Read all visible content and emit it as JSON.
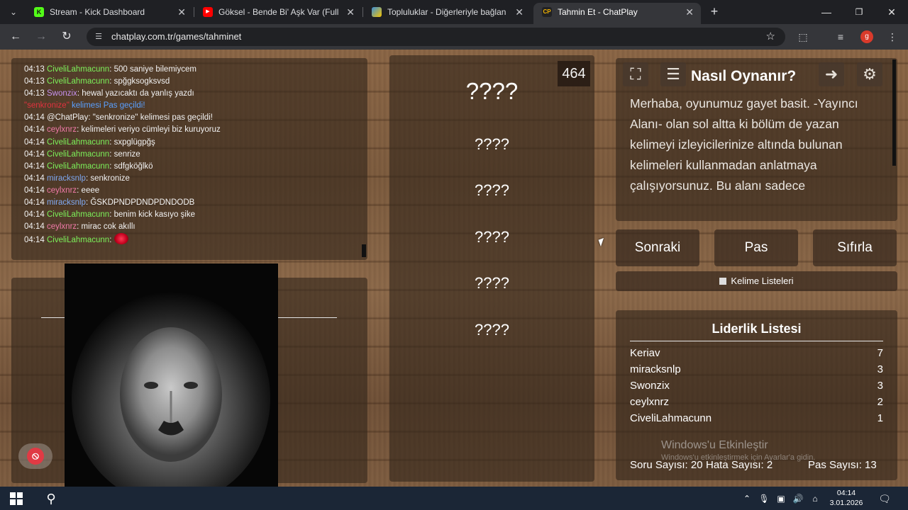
{
  "browser": {
    "tabs": [
      {
        "title": "Stream - Kick Dashboard",
        "favicon": "kick-icon",
        "color": "#53fc18",
        "glyph": "K"
      },
      {
        "title": "Göksel - Bende Bi' Aşk Var (Full",
        "favicon": "youtube-icon",
        "color": "#ff0000",
        "glyph": "▶"
      },
      {
        "title": "Topluluklar - Diğerleriyle bağlan",
        "favicon": "community-icon",
        "color": "#3b8fd9",
        "glyph": "◆"
      },
      {
        "title": "Tahmin Et - ChatPlay",
        "favicon": "chatplay-icon",
        "color": "#f5b400",
        "glyph": "CP"
      }
    ],
    "url": "chatplay.com.tr/games/tahminet",
    "profile_letter": "g"
  },
  "chat": {
    "lines": [
      {
        "time": "04:13",
        "user": "CiveliLahmacunn",
        "color": "#7cf05a",
        "text": ": 500 saniye bilemiycem"
      },
      {
        "time": "04:13",
        "user": "CiveliLahmacunn",
        "color": "#7cf05a",
        "text": ": spğgksogksvsd"
      },
      {
        "time": "04:13",
        "user": "Swonzix",
        "color": "#c792f0",
        "text": ": hewal yazıcaktı da yanlış yazdı"
      },
      {
        "time": "",
        "user": "\"senkronize\"",
        "color": "#e0323e",
        "text": " kelimesi Pas geçildi!",
        "system": true
      },
      {
        "time": "04:14",
        "user": "@ChatPlay",
        "color": "#f2f2f2",
        "text": ": \"senkronize\" kelimesi pas geçildi!"
      },
      {
        "time": "04:14",
        "user": "ceylxnrz",
        "color": "#f07aa8",
        "text": ": kelimeleri veriyo cümleyi biz kuruyoruz"
      },
      {
        "time": "04:14",
        "user": "CiveliLahmacunn",
        "color": "#7cf05a",
        "text": ": sxpglügpğş"
      },
      {
        "time": "04:14",
        "user": "CiveliLahmacunn",
        "color": "#7cf05a",
        "text": ": senrize"
      },
      {
        "time": "04:14",
        "user": "CiveliLahmacunn",
        "color": "#7cf05a",
        "text": ": sdfgköğlkö"
      },
      {
        "time": "04:14",
        "user": "miracksnlp",
        "color": "#7fa8f0",
        "text": ": senkronize"
      },
      {
        "time": "04:14",
        "user": "ceylxnrz",
        "color": "#f07aa8",
        "text": ": eeee"
      },
      {
        "time": "04:14",
        "user": "miracksnlp",
        "color": "#7fa8f0",
        "text": ": ĞSKDPNDPDNDPDNDODB"
      },
      {
        "time": "04:14",
        "user": "CiveliLahmacunn",
        "color": "#7cf05a",
        "text": ": benim kick kasıyo şike"
      },
      {
        "time": "04:14",
        "user": "ceylxnrz",
        "color": "#f07aa8",
        "text": ": mirac cok akıllı"
      },
      {
        "time": "04:14",
        "user": "CiveliLahmacunn",
        "color": "#7cf05a",
        "text": ": ",
        "emote": true
      }
    ]
  },
  "game": {
    "score": "464",
    "main_word": "????",
    "words": [
      "????",
      "????",
      "????",
      "????",
      "????"
    ]
  },
  "howto": {
    "title": "Nasıl Oynanır?",
    "text": "Merhaba, oyunumuz gayet basit. -Yayıncı Alanı- olan sol altta ki bölüm de yazan kelimeyi izleyicilerinize altında bulunan kelimeleri kullanmadan anlatmaya çalışıyorsunuz. Bu alanı sadece"
  },
  "controls": {
    "next": "Sonraki",
    "pass": "Pas",
    "reset": "Sıfırla",
    "word_lists": "Kelime Listeleri"
  },
  "leaderboard": {
    "title": "Liderlik Listesi",
    "rows": [
      {
        "name": "Keriav",
        "score": "7"
      },
      {
        "name": "miracksnlp",
        "score": "3"
      },
      {
        "name": "Swonzix",
        "score": "3"
      },
      {
        "name": "ceylxnrz",
        "score": "2"
      },
      {
        "name": "CiveliLahmacunn",
        "score": "1"
      }
    ],
    "question_count": "Soru Sayısı: 20",
    "error_count": "Hata Sayısı: 2",
    "pass_count": "Pas Sayısı: 13"
  },
  "watermark": {
    "title": "Windows'u Etkinleştir",
    "subtitle": "Windows'u etkinleştirmek için Ayarlar'a gidin."
  },
  "taskbar": {
    "time": "04:14",
    "date": "3.01.2026"
  }
}
